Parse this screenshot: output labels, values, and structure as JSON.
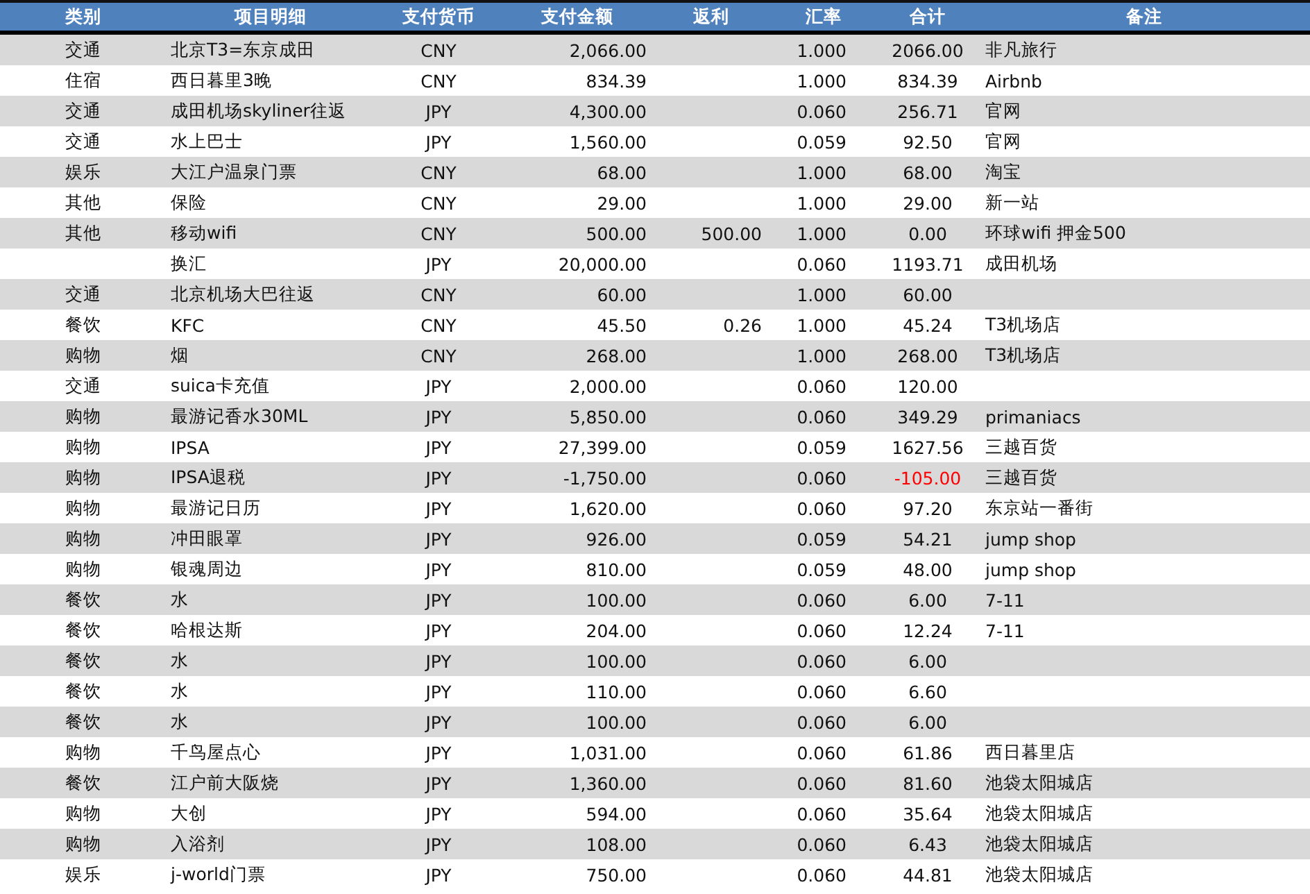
{
  "table": {
    "columns": [
      "类别",
      "项目明细",
      "支付货币",
      "支付金额",
      "返利",
      "汇率",
      "合计",
      "备注"
    ],
    "rows": [
      {
        "category": "交通",
        "item": "北京T3=东京成田",
        "currency": "CNY",
        "amount": "2,066.00",
        "rate": "1.000",
        "total": "2066.00",
        "total_negative": false,
        "note": "非凡旅行"
      },
      {
        "category": "住宿",
        "item": "西日暮里3晚",
        "currency": "CNY",
        "amount": "834.39",
        "rate": "1.000",
        "total": "834.39",
        "total_negative": false,
        "note": "Airbnb"
      },
      {
        "category": "交通",
        "item": "成田机场skyliner往返",
        "currency": "JPY",
        "amount": "4,300.00",
        "rate": "0.060",
        "total": "256.71",
        "total_negative": false,
        "note": "官网"
      },
      {
        "category": "交通",
        "item": "水上巴士",
        "currency": "JPY",
        "amount": "1,560.00",
        "rate": "0.059",
        "total": "92.50",
        "total_negative": false,
        "note": "官网"
      },
      {
        "category": "娱乐",
        "item": "大江户温泉门票",
        "currency": "CNY",
        "amount": "68.00",
        "rate": "1.000",
        "total": "68.00",
        "total_negative": false,
        "note": "淘宝"
      },
      {
        "category": "其他",
        "item": "保险",
        "currency": "CNY",
        "amount": "29.00",
        "rate": "1.000",
        "total": "29.00",
        "total_negative": false,
        "note": "新一站"
      },
      {
        "category": "其他",
        "item": "移动wifi",
        "currency": "CNY",
        "amount": "500.00",
        "rebate": "500.00",
        "rate": "1.000",
        "total": "0.00",
        "total_negative": false,
        "note": "环球wifi 押金500"
      },
      {
        "item": "换汇",
        "currency": "JPY",
        "amount": "20,000.00",
        "rate": "0.060",
        "total": "1193.71",
        "total_negative": false,
        "note": "成田机场"
      },
      {
        "category": "交通",
        "item": "北京机场大巴往返",
        "currency": "CNY",
        "amount": "60.00",
        "rate": "1.000",
        "total": "60.00",
        "total_negative": false
      },
      {
        "category": "餐饮",
        "item": "KFC",
        "currency": "CNY",
        "amount": "45.50",
        "rebate": "0.26",
        "rate": "1.000",
        "total": "45.24",
        "total_negative": false,
        "note": "T3机场店"
      },
      {
        "category": "购物",
        "item": "烟",
        "currency": "CNY",
        "amount": "268.00",
        "rate": "1.000",
        "total": "268.00",
        "total_negative": false,
        "note": "T3机场店"
      },
      {
        "category": "交通",
        "item": "suica卡充值",
        "currency": "JPY",
        "amount": "2,000.00",
        "rate": "0.060",
        "total": "120.00",
        "total_negative": false
      },
      {
        "category": "购物",
        "item": "最游记香水30ML",
        "currency": "JPY",
        "amount": "5,850.00",
        "rate": "0.060",
        "total": "349.29",
        "total_negative": false,
        "note": "primaniacs"
      },
      {
        "category": "购物",
        "item": "IPSA",
        "currency": "JPY",
        "amount": "27,399.00",
        "rate": "0.059",
        "total": "1627.56",
        "total_negative": false,
        "note": "三越百货"
      },
      {
        "category": "购物",
        "item": "IPSA退税",
        "currency": "JPY",
        "amount": "-1,750.00",
        "rate": "0.060",
        "total": "-105.00",
        "total_negative": true,
        "note": "三越百货"
      },
      {
        "category": "购物",
        "item": "最游记日历",
        "currency": "JPY",
        "amount": "1,620.00",
        "rate": "0.060",
        "total": "97.20",
        "total_negative": false,
        "note": "东京站一番街"
      },
      {
        "category": "购物",
        "item": "冲田眼罩",
        "currency": "JPY",
        "amount": "926.00",
        "rate": "0.059",
        "total": "54.21",
        "total_negative": false,
        "note": "jump shop"
      },
      {
        "category": "购物",
        "item": "银魂周边",
        "currency": "JPY",
        "amount": "810.00",
        "rate": "0.059",
        "total": "48.00",
        "total_negative": false,
        "note": "jump shop"
      },
      {
        "category": "餐饮",
        "item": "水",
        "currency": "JPY",
        "amount": "100.00",
        "rate": "0.060",
        "total": "6.00",
        "total_negative": false,
        "note": "7-11"
      },
      {
        "category": "餐饮",
        "item": "哈根达斯",
        "currency": "JPY",
        "amount": "204.00",
        "rate": "0.060",
        "total": "12.24",
        "total_negative": false,
        "note": "7-11"
      },
      {
        "category": "餐饮",
        "item": "水",
        "currency": "JPY",
        "amount": "100.00",
        "rate": "0.060",
        "total": "6.00",
        "total_negative": false
      },
      {
        "category": "餐饮",
        "item": "水",
        "currency": "JPY",
        "amount": "110.00",
        "rate": "0.060",
        "total": "6.60",
        "total_negative": false
      },
      {
        "category": "餐饮",
        "item": "水",
        "currency": "JPY",
        "amount": "100.00",
        "rate": "0.060",
        "total": "6.00",
        "total_negative": false
      },
      {
        "category": "购物",
        "item": "千鸟屋点心",
        "currency": "JPY",
        "amount": "1,031.00",
        "rate": "0.060",
        "total": "61.86",
        "total_negative": false,
        "note": "西日暮里店"
      },
      {
        "category": "餐饮",
        "item": "江户前大阪烧",
        "currency": "JPY",
        "amount": "1,360.00",
        "rate": "0.060",
        "total": "81.60",
        "total_negative": false,
        "note": "池袋太阳城店"
      },
      {
        "category": "购物",
        "item": "大创",
        "currency": "JPY",
        "amount": "594.00",
        "rate": "0.060",
        "total": "35.64",
        "total_negative": false,
        "note": "池袋太阳城店"
      },
      {
        "category": "购物",
        "item": "入浴剂",
        "currency": "JPY",
        "amount": "108.00",
        "rate": "0.060",
        "total": "6.43",
        "total_negative": false,
        "note": "池袋太阳城店"
      },
      {
        "category": "娱乐",
        "item": "j-world门票",
        "currency": "JPY",
        "amount": "750.00",
        "rate": "0.060",
        "total": "44.81",
        "total_negative": false,
        "note": "池袋太阳城店"
      }
    ]
  }
}
